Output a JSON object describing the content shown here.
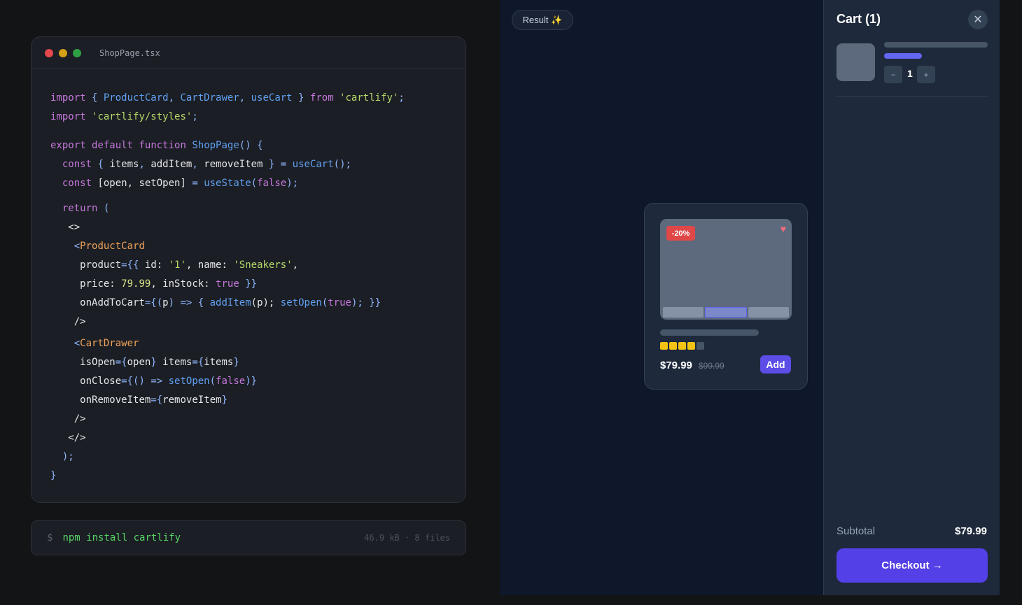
{
  "editor": {
    "filename": "ShopPage.tsx",
    "lines": [
      {
        "tokens": [
          [
            "kw",
            "import"
          ],
          [
            "punc",
            " { "
          ],
          [
            "fn",
            "ProductCard"
          ],
          [
            "punc",
            ", "
          ],
          [
            "fn",
            "CartDrawer"
          ],
          [
            "punc",
            ", "
          ],
          [
            "fn",
            "useCart"
          ],
          [
            "punc",
            " } "
          ],
          [
            "kw",
            "from"
          ],
          [
            "punc",
            " "
          ],
          [
            "str",
            "'cartlify'"
          ],
          [
            "punc",
            ";"
          ]
        ]
      },
      {
        "tokens": [
          [
            "kw",
            "import"
          ],
          [
            "punc",
            " "
          ],
          [
            "str",
            "'cartlify/styles'"
          ],
          [
            "punc",
            ";"
          ]
        ]
      },
      {
        "tokens": [
          [
            "kw",
            "export"
          ],
          [
            "punc",
            " "
          ],
          [
            "kw",
            "default"
          ],
          [
            "punc",
            " "
          ],
          [
            "kw",
            "function"
          ],
          [
            "punc",
            " "
          ],
          [
            "fn",
            "ShopPage"
          ],
          [
            "punc",
            "() {"
          ]
        ]
      },
      {
        "tokens": [
          [
            "punc",
            "  "
          ],
          [
            "kw",
            "const"
          ],
          [
            "punc",
            " { "
          ],
          [
            "plain",
            "items"
          ],
          [
            "punc",
            ", "
          ],
          [
            "plain",
            "addItem"
          ],
          [
            "punc",
            ", "
          ],
          [
            "plain",
            "removeItem"
          ],
          [
            "punc",
            " } = "
          ],
          [
            "fn",
            "useCart"
          ],
          [
            "punc",
            "();"
          ]
        ]
      },
      {
        "tokens": [
          [
            "punc",
            "  "
          ],
          [
            "kw",
            "const"
          ],
          [
            "punc",
            " "
          ],
          [
            "plain",
            "[open, setOpen]"
          ],
          [
            "punc",
            " = "
          ],
          [
            "fn",
            "useState"
          ],
          [
            "punc",
            "("
          ],
          [
            "bool",
            "false"
          ],
          [
            "punc",
            ");"
          ]
        ]
      },
      {
        "tokens": [
          [
            "punc",
            "  "
          ],
          [
            "kw",
            "return"
          ],
          [
            "punc",
            " ("
          ]
        ]
      },
      {
        "tokens": [
          [
            "punc",
            "   "
          ],
          [
            "plain",
            "<>"
          ]
        ]
      },
      {
        "tokens": [
          [
            "punc",
            "    <"
          ],
          [
            "tag",
            "ProductCard"
          ]
        ]
      },
      {
        "tokens": [
          [
            "punc",
            "     "
          ],
          [
            "plain",
            "product"
          ],
          [
            "punc",
            "={{ "
          ],
          [
            "plain",
            "id: "
          ],
          [
            "str",
            "'1'"
          ],
          [
            "plain",
            ", name: "
          ],
          [
            "str",
            "'Sneakers'"
          ],
          [
            "plain",
            ","
          ]
        ]
      },
      {
        "tokens": [
          [
            "punc",
            "     "
          ],
          [
            "plain",
            "price: "
          ],
          [
            "num",
            "79.99"
          ],
          [
            "plain",
            ", inStock: "
          ],
          [
            "bool",
            "true"
          ],
          [
            "punc",
            " }}"
          ]
        ]
      },
      {
        "tokens": [
          [
            "punc",
            "     "
          ],
          [
            "plain",
            "onAddToCart"
          ],
          [
            "punc",
            "={("
          ],
          [
            "plain",
            "p"
          ],
          [
            "punc",
            ") => { "
          ],
          [
            "fn",
            "addItem"
          ],
          [
            "plain",
            "(p); "
          ],
          [
            "fn",
            "setOpen"
          ],
          [
            "punc",
            "("
          ],
          [
            "bool",
            "true"
          ],
          [
            "punc",
            "); }}"
          ]
        ]
      },
      {
        "tokens": [
          [
            "punc",
            "    "
          ],
          [
            "plain",
            "/>"
          ]
        ]
      },
      {
        "tokens": [
          [
            "punc",
            "    <"
          ],
          [
            "tag",
            "CartDrawer"
          ]
        ]
      },
      {
        "tokens": [
          [
            "punc",
            "     "
          ],
          [
            "plain",
            "isOpen"
          ],
          [
            "punc",
            "={"
          ],
          [
            "plain",
            "open"
          ],
          [
            "punc",
            "} "
          ],
          [
            "plain",
            "items"
          ],
          [
            "punc",
            "={"
          ],
          [
            "plain",
            "items"
          ],
          [
            "punc",
            "}"
          ]
        ]
      },
      {
        "tokens": [
          [
            "punc",
            "     "
          ],
          [
            "plain",
            "onClose"
          ],
          [
            "punc",
            "={() => "
          ],
          [
            "fn",
            "setOpen"
          ],
          [
            "punc",
            "("
          ],
          [
            "bool",
            "false"
          ],
          [
            "punc",
            ")}"
          ]
        ]
      },
      {
        "tokens": [
          [
            "punc",
            "     "
          ],
          [
            "plain",
            "onRemoveItem"
          ],
          [
            "punc",
            "={"
          ],
          [
            "plain",
            "removeItem"
          ],
          [
            "punc",
            "}"
          ]
        ]
      },
      {
        "tokens": [
          [
            "punc",
            "    "
          ],
          [
            "plain",
            "/>"
          ]
        ]
      },
      {
        "tokens": [
          [
            "punc",
            "   "
          ],
          [
            "plain",
            "</>"
          ]
        ]
      },
      {
        "tokens": [
          [
            "punc",
            "  );"
          ]
        ]
      },
      {
        "tokens": [
          [
            "punc",
            "}"
          ]
        ]
      }
    ]
  },
  "terminal": {
    "prompt": "$",
    "command": "npm install cartlify",
    "meta": "46.9 kB · 8 files"
  },
  "result": {
    "label": "Result",
    "sparkle_icon": "✨"
  },
  "product": {
    "badge": "-20%",
    "heart_icon": "♥",
    "rating_filled": 4,
    "rating_total": 5,
    "price": "$79.99",
    "old_price": "$99.99",
    "add_label": "Add"
  },
  "cart": {
    "title": "Cart (1)",
    "close_icon": "✕",
    "minus_label": "−",
    "plus_label": "+",
    "quantity": "1",
    "subtotal_label": "Subtotal",
    "subtotal_value": "$79.99",
    "checkout_label": "Checkout →"
  },
  "colors": {
    "accent": "#5b4de6",
    "badge": "#e04848",
    "star": "#f2c314"
  }
}
